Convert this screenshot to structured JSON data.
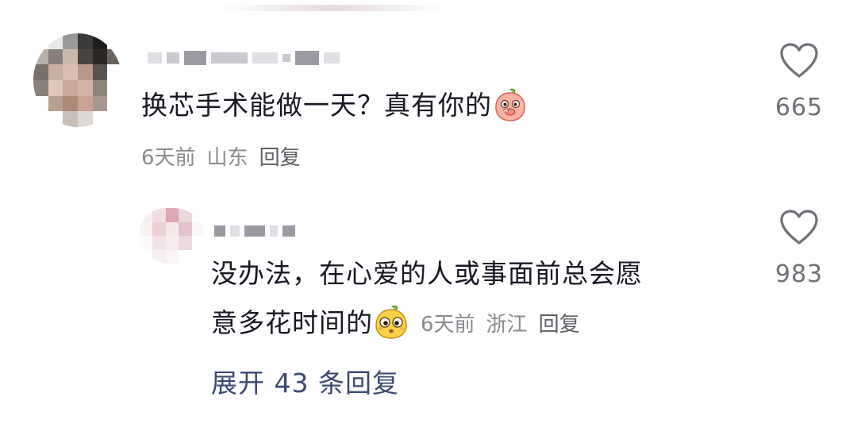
{
  "comments": [
    {
      "text": "换芯手术能做一天？真有你的",
      "time": "6天前",
      "location": "山东",
      "reply_label": "回复",
      "likes": "665",
      "emoji": "peach-covering-mouth-emoji"
    }
  ],
  "reply": {
    "line1": "没办法，在心爱的人或事面前总会愿",
    "line2": "意多花时间的",
    "time": "6天前",
    "location": "浙江",
    "reply_label": "回复",
    "likes": "983",
    "emoji": "yellow-mango-face-emoji"
  },
  "expand_label": "展开 43 条回复",
  "colors": {
    "text": "#161823",
    "meta": "#8a8b91",
    "link": "#3c4a72",
    "like_count": "#6f7076"
  }
}
